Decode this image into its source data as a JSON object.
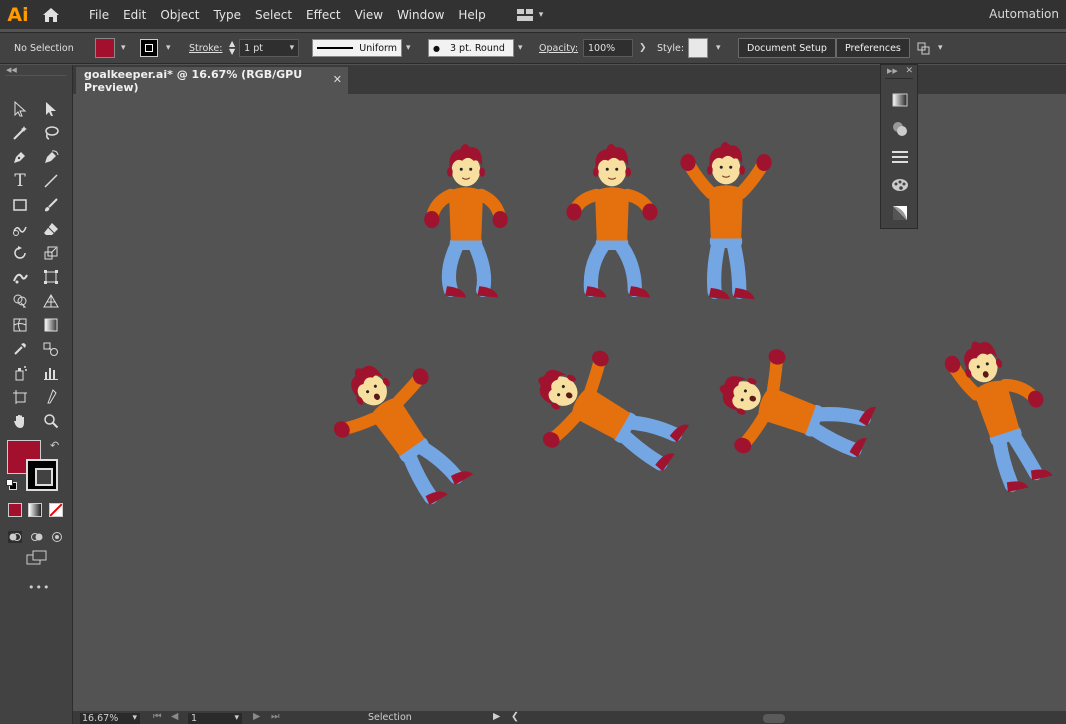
{
  "app": {
    "logo": "Ai",
    "menu": [
      "File",
      "Edit",
      "Object",
      "Type",
      "Select",
      "Effect",
      "View",
      "Window",
      "Help"
    ],
    "workspace": "Automation"
  },
  "control_bar": {
    "selection": "No Selection",
    "fill_color": "#a3102e",
    "stroke_label": "Stroke:",
    "stroke_weight": "1 pt",
    "stroke_profile": "Uniform",
    "brush": "3 pt. Round",
    "opacity_label": "Opacity:",
    "opacity": "100%",
    "style_label": "Style:",
    "document_setup": "Document Setup",
    "preferences": "Preferences"
  },
  "document": {
    "tab_title": "goalkeeper.ai* @ 16.67% (RGB/GPU Preview)"
  },
  "status": {
    "zoom": "16.67%",
    "artboard": "1",
    "tool": "Selection"
  },
  "colors": {
    "hair": "#a0132e",
    "skin": "#f7dfa0",
    "shirt": "#e5700e",
    "pants": "#73a6e3",
    "shoes": "#a0132e",
    "fill": "#a3102e"
  }
}
